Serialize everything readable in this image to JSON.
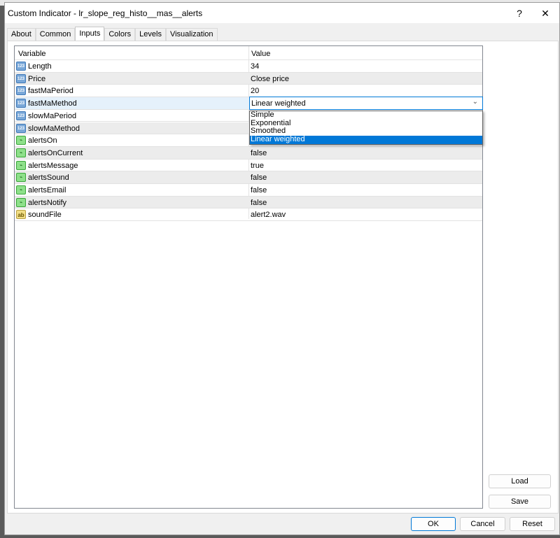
{
  "window": {
    "title": "Custom Indicator - lr_slope_reg_histo__mas__alerts",
    "help": "?",
    "close": "✕"
  },
  "tabs": [
    {
      "label": "About"
    },
    {
      "label": "Common"
    },
    {
      "label": "Inputs",
      "active": true
    },
    {
      "label": "Colors"
    },
    {
      "label": "Levels"
    },
    {
      "label": "Visualization"
    }
  ],
  "grid": {
    "headers": {
      "variable": "Variable",
      "value": "Value"
    },
    "rows": [
      {
        "type": "num",
        "icon": "123",
        "name": "Length",
        "value": "34"
      },
      {
        "type": "num",
        "icon": "123",
        "name": "Price",
        "value": "Close price"
      },
      {
        "type": "num",
        "icon": "123",
        "name": "fastMaPeriod",
        "value": "20"
      },
      {
        "type": "num",
        "icon": "123",
        "name": "fastMaMethod",
        "value": "Linear weighted"
      },
      {
        "type": "num",
        "icon": "123",
        "name": "slowMaPeriod",
        "value": ""
      },
      {
        "type": "num",
        "icon": "123",
        "name": "slowMaMethod",
        "value": ""
      },
      {
        "type": "bool",
        "icon": "bool",
        "name": "alertsOn",
        "value": ""
      },
      {
        "type": "bool",
        "icon": "bool",
        "name": "alertsOnCurrent",
        "value": "false"
      },
      {
        "type": "bool",
        "icon": "bool",
        "name": "alertsMessage",
        "value": "true"
      },
      {
        "type": "bool",
        "icon": "bool",
        "name": "alertsSound",
        "value": "false"
      },
      {
        "type": "bool",
        "icon": "bool",
        "name": "alertsEmail",
        "value": "false"
      },
      {
        "type": "bool",
        "icon": "bool",
        "name": "alertsNotify",
        "value": "false"
      },
      {
        "type": "str",
        "icon": "ab",
        "name": "soundFile",
        "value": "alert2.wav"
      }
    ],
    "dropdown": {
      "selected": "Linear weighted",
      "options": [
        "Simple",
        "Exponential",
        "Smoothed",
        "Linear weighted"
      ]
    }
  },
  "buttons": {
    "load": "Load",
    "save": "Save",
    "ok": "OK",
    "cancel": "Cancel",
    "reset": "Reset"
  },
  "colors": {
    "accent": "#0078d7"
  }
}
